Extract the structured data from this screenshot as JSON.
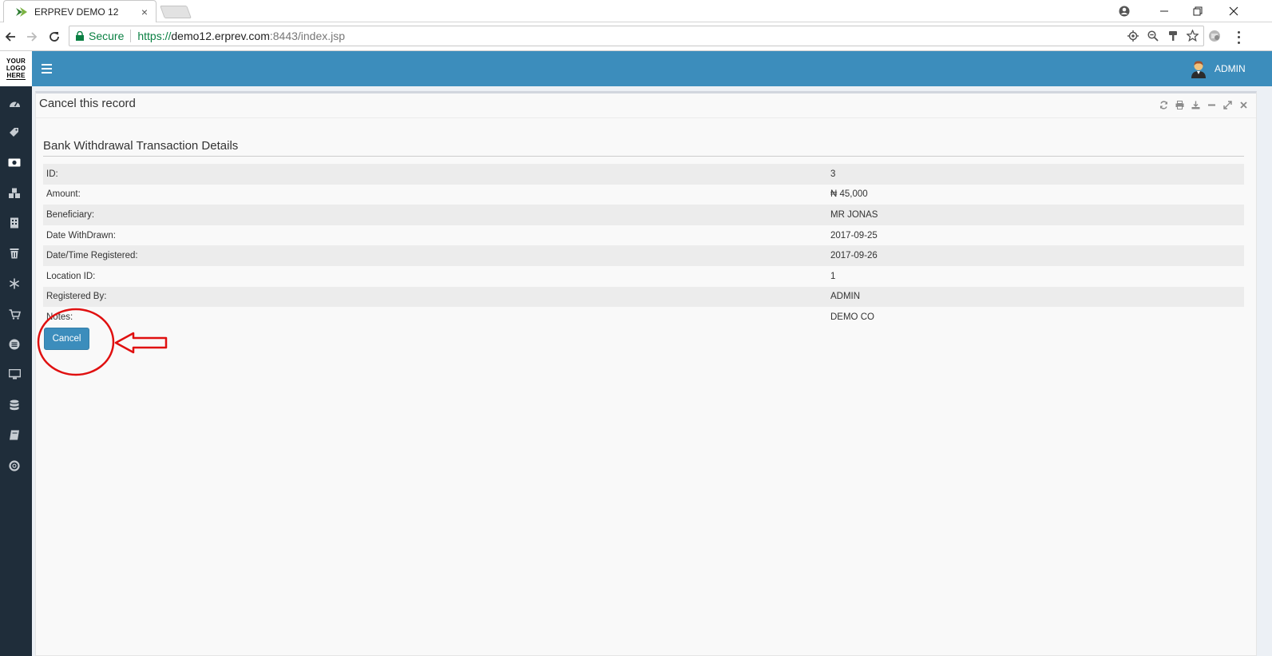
{
  "browser": {
    "tab_title": "ERPREV DEMO 12",
    "tab_close": "×",
    "secure_label": "Secure",
    "url_scheme": "https://",
    "url_host": "demo12.erprev.com",
    "url_path": ":8443/index.jsp",
    "window_controls": [
      "user-account-icon",
      "minimize-icon",
      "restore-icon",
      "close-icon"
    ],
    "omnibox_icons": [
      "location-icon",
      "zoom-out-icon",
      "key-icon",
      "star-icon"
    ]
  },
  "app": {
    "logo_lines": [
      "YOUR",
      "LOGO",
      "HERE"
    ],
    "user_name": "ADMIN",
    "accent_color": "#3c8dbc",
    "sidebar_color": "#1f2d3a",
    "sidebar_icons": [
      "dashboard-icon",
      "tag-icon",
      "money-icon",
      "cubes-icon",
      "building-icon",
      "trash-icon",
      "snowflake-icon",
      "cart-icon",
      "circle-menu-icon",
      "monitor-icon",
      "database-icon",
      "book-icon",
      "lifebuoy-icon"
    ]
  },
  "panel": {
    "title": "Cancel this record",
    "tools": [
      "refresh-icon",
      "print-icon",
      "download-icon",
      "minus-icon",
      "expand-icon",
      "close-icon"
    ],
    "section_title": "Bank Withdrawal Transaction Details",
    "rows": [
      {
        "label": "ID:",
        "value": "3"
      },
      {
        "label": "Amount:",
        "value": "₦ 45,000"
      },
      {
        "label": "Beneficiary:",
        "value": "MR JONAS"
      },
      {
        "label": "Date WithDrawn:",
        "value": "2017-09-25"
      },
      {
        "label": "Date/Time Registered:",
        "value": "2017-09-26"
      },
      {
        "label": "Location ID:",
        "value": "1"
      },
      {
        "label": "Registered By:",
        "value": "ADMIN"
      },
      {
        "label": "Notes:",
        "value": "DEMO CO"
      }
    ],
    "cancel_label": "Cancel"
  },
  "annotation": {
    "color": "#e01010",
    "shapes": [
      "circle",
      "arrow"
    ]
  }
}
